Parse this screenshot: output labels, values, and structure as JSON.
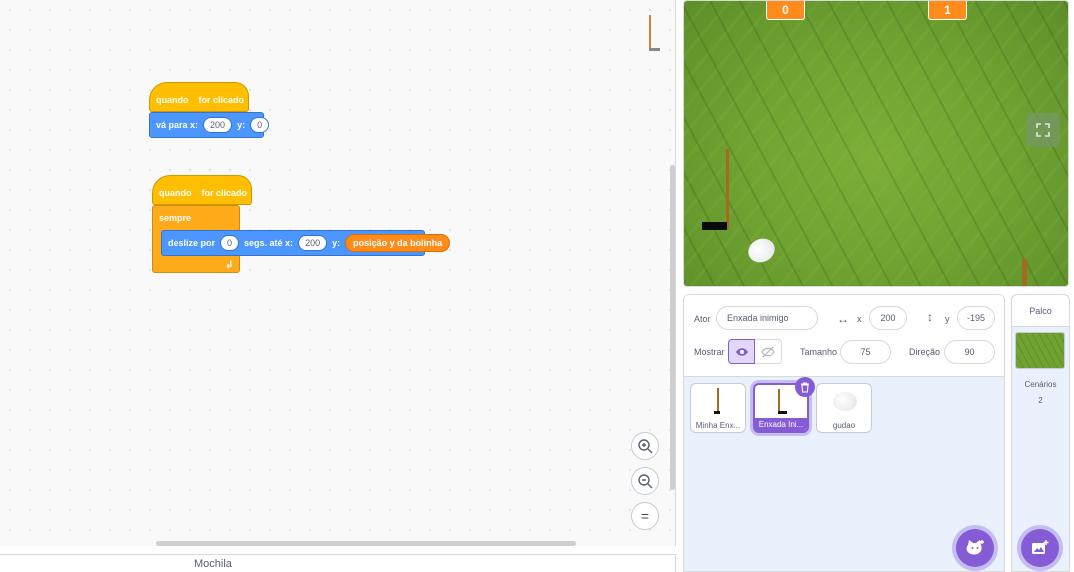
{
  "scripts": {
    "script1": {
      "hat_prefix": "quando",
      "hat_suffix": "for clicado",
      "goto_label": "vá para x:",
      "goto_x": "200",
      "goto_y_label": "y:",
      "goto_y": "0"
    },
    "script2": {
      "hat_prefix": "quando",
      "hat_suffix": "for clicado",
      "forever_label": "sempre",
      "glide_label": "deslize por",
      "glide_secs": "0",
      "glide_to_label": "segs. até x:",
      "glide_x": "200",
      "glide_y_label": "y:",
      "glide_y_reporter": "posição y da bolinha"
    }
  },
  "backpack": {
    "label": "Mochila"
  },
  "stage": {
    "monitor_left": "0",
    "monitor_right": "1"
  },
  "sprite_info": {
    "sprite_label": "Ator",
    "sprite_name": "Enxada inimigo",
    "x_label": "x",
    "x_value": "200",
    "y_label": "y",
    "y_value": "-195",
    "show_label": "Mostrar",
    "size_label": "Tamanho",
    "size_value": "75",
    "direction_label": "Direção",
    "direction_value": "90"
  },
  "sprites": [
    {
      "name": "Minha Enx..."
    },
    {
      "name": "Enxada Ini..."
    },
    {
      "name": "gudao"
    }
  ],
  "stage_selector": {
    "title": "Palco",
    "backdrops_label": "Cenários",
    "backdrops_count": "2"
  },
  "colors": {
    "events": "#ffbf00",
    "motion": "#4c97ff",
    "control": "#ffab19",
    "operator": "#ff8c1a",
    "accent": "#855cd6"
  },
  "icons": {
    "zoom_in": "zoom-in-icon",
    "zoom_out": "zoom-out-icon",
    "zoom_reset": "equals-icon",
    "flag": "green-flag-icon",
    "show": "eye-icon",
    "hide": "eye-off-icon",
    "delete": "trash-icon",
    "add_sprite": "cat-plus-icon",
    "add_backdrop": "image-plus-icon"
  }
}
